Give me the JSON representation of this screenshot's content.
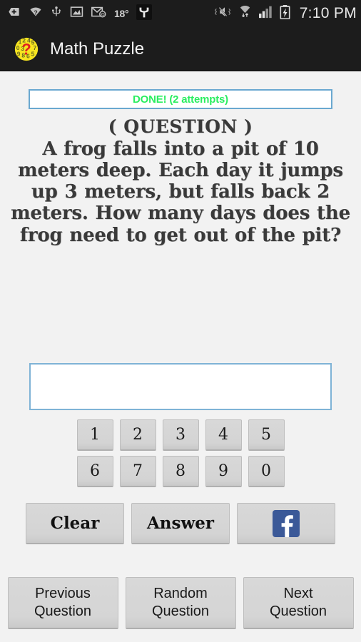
{
  "status_bar": {
    "icons_left": [
      {
        "name": "download-badge-icon"
      },
      {
        "name": "wifi-unknown-icon"
      },
      {
        "name": "usb-icon"
      },
      {
        "name": "screenshot-image-icon"
      },
      {
        "name": "email-icon"
      }
    ],
    "temperature": "18°",
    "icons_left_after": [
      {
        "name": "app-y-icon"
      }
    ],
    "icons_right": [
      {
        "name": "vibrate-mute-icon"
      },
      {
        "name": "wifi-transfer-icon"
      },
      {
        "name": "signal-bars-icon"
      },
      {
        "name": "battery-charging-icon"
      }
    ],
    "clock": "7:10 PM"
  },
  "action_bar": {
    "app_icon": "math-puzzle-icon",
    "title": "Math Puzzle"
  },
  "banner": {
    "text": "DONE! (2 attempts)",
    "text_color": "#2aee60",
    "border_color": "#6aa8d0"
  },
  "question": {
    "title": "( QUESTION )",
    "text": "A frog falls into a pit of 10 meters deep. Each day it jumps up 3 meters, but falls back 2 meters. How many days does the frog need to get out of the pit?"
  },
  "answer_field": {
    "value": "",
    "placeholder": ""
  },
  "keypad": {
    "row1": [
      "1",
      "2",
      "3",
      "4",
      "5"
    ],
    "row2": [
      "6",
      "7",
      "8",
      "9",
      "0"
    ]
  },
  "actions": {
    "clear_label": "Clear",
    "answer_label": "Answer",
    "facebook_icon": "facebook-icon",
    "facebook_color": "#3b5998"
  },
  "navigation": [
    {
      "name": "previous-question-button",
      "line1": "Previous",
      "line2": "Question"
    },
    {
      "name": "random-question-button",
      "line1": "Random",
      "line2": "Question"
    },
    {
      "name": "next-question-button",
      "line1": "Next",
      "line2": "Question"
    }
  ]
}
